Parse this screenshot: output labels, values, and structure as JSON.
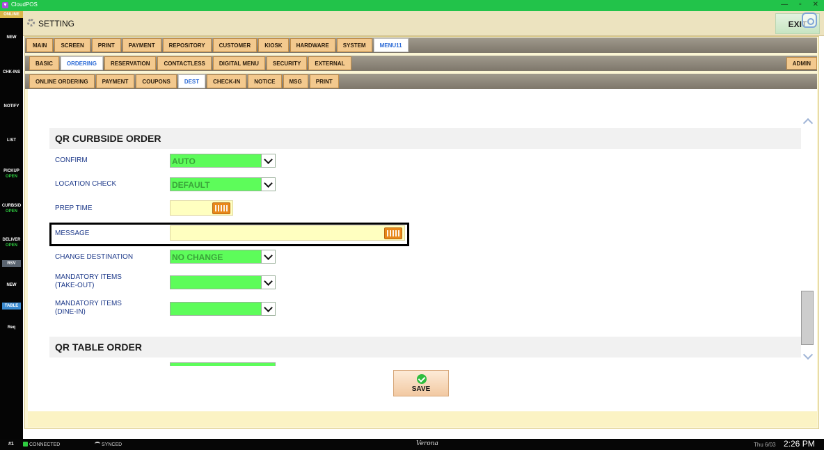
{
  "window": {
    "app_title": "CloudPOS",
    "controls": [
      "—",
      "▫",
      "✕"
    ]
  },
  "sidebar": {
    "online": "ONLINE",
    "items": [
      {
        "label": "NEW",
        "sub": ""
      },
      {
        "label": "CHK-INS",
        "sub": ""
      },
      {
        "label": "NOTIFY",
        "sub": ""
      },
      {
        "label": "LIST",
        "sub": ""
      },
      {
        "label": "PICKUP",
        "sub": "OPEN"
      },
      {
        "label": "CURBSID",
        "sub": "OPEN"
      },
      {
        "label": "DELIVER",
        "sub": "OPEN"
      }
    ],
    "rsv": "RSV",
    "rsv_new": "NEW",
    "table": "TABLE",
    "req": "Req"
  },
  "header": {
    "title": "SETTING",
    "exit_label": "EXIT"
  },
  "tabs_main": [
    "MAIN",
    "SCREEN",
    "PRINT",
    "PAYMENT",
    "REPOSITORY",
    "CUSTOMER",
    "KIOSK",
    "HARDWARE",
    "SYSTEM",
    "MENU11"
  ],
  "tabs_main_active": "MENU11",
  "tabs_sub": [
    "BASIC",
    "ORDERING",
    "RESERVATION",
    "CONTACTLESS",
    "DIGITAL MENU",
    "SECURITY",
    "EXTERNAL"
  ],
  "tabs_sub_active": "ORDERING",
  "admin_label": "ADMIN",
  "tabs_third": [
    "ONLINE ORDERING",
    "PAYMENT",
    "COUPONS",
    "DEST",
    "CHECK-IN",
    "NOTICE",
    "MSG",
    "PRINT"
  ],
  "tabs_third_active": "DEST",
  "section1": {
    "title": "QR CURBSIDE ORDER",
    "fields": {
      "confirm": {
        "label": "CONFIRM",
        "value": "AUTO"
      },
      "location_check": {
        "label": "LOCATION CHECK",
        "value": "DEFAULT"
      },
      "prep_time": {
        "label": "PREP TIME",
        "value": ""
      },
      "message": {
        "label": "MESSAGE",
        "value": ""
      },
      "change_destination": {
        "label": "CHANGE DESTINATION",
        "value": "NO CHANGE"
      },
      "mandatory_takeout": {
        "label_line1": "MANDATORY ITEMS",
        "label_line2": "(TAKE-OUT)",
        "value": ""
      },
      "mandatory_dinein": {
        "label_line1": "MANDATORY ITEMS",
        "label_line2": "(DINE-IN)",
        "value": ""
      }
    }
  },
  "section2": {
    "title": "QR TABLE ORDER"
  },
  "save_label": "SAVE",
  "status": {
    "terminal": "#1",
    "connected": "CONNECTED",
    "synced": "SYNCED",
    "store": "Verona",
    "date": "Thu 6/03",
    "time": "2:26 PM"
  },
  "colors": {
    "field_green": "#5dfc5a",
    "tab_orange": "#f3c98e",
    "active_tab_text": "#2b6ad6",
    "label_blue": "#1e3a8a"
  }
}
